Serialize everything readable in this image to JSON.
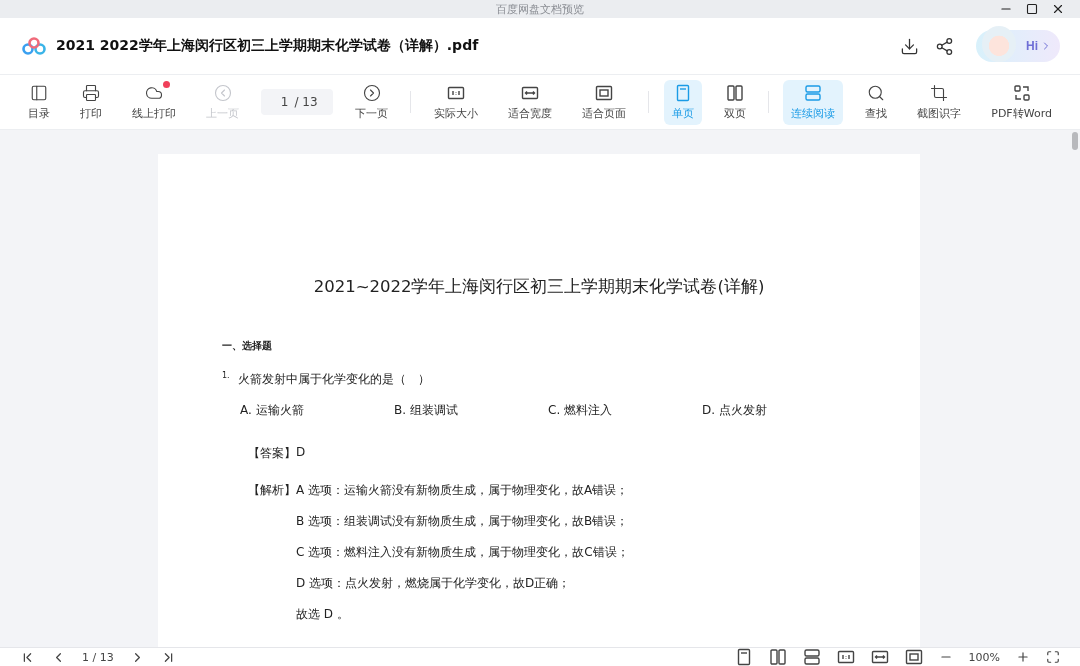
{
  "window": {
    "title": "百度网盘文档预览"
  },
  "header": {
    "file_name": "2021 2022学年上海闵行区初三上学期期末化学试卷（详解）.pdf",
    "assistant_label": "Hi"
  },
  "toolbar": [
    [
      {
        "kind": "button",
        "label": "目录",
        "disabled": false,
        "selected": false,
        "badge": false
      },
      {
        "kind": "button",
        "label": "打印",
        "disabled": false,
        "selected": false,
        "badge": false
      },
      {
        "kind": "button",
        "label": "线上打印",
        "disabled": false,
        "selected": false,
        "badge": true
      },
      {
        "kind": "button",
        "label": "上一页",
        "disabled": true,
        "selected": false,
        "badge": false
      },
      {
        "kind": "page",
        "value": "1",
        "total": "/ 13"
      },
      {
        "kind": "button",
        "label": "下一页",
        "disabled": false,
        "selected": false,
        "badge": false
      }
    ],
    [
      {
        "kind": "button",
        "label": "实际大小",
        "disabled": false,
        "selected": false,
        "badge": false
      },
      {
        "kind": "button",
        "label": "适合宽度",
        "disabled": false,
        "selected": false,
        "badge": false
      },
      {
        "kind": "button",
        "label": "适合页面",
        "disabled": false,
        "selected": false,
        "badge": false
      }
    ],
    [
      {
        "kind": "button",
        "label": "单页",
        "disabled": false,
        "selected": true,
        "badge": false
      },
      {
        "kind": "button",
        "label": "双页",
        "disabled": false,
        "selected": false,
        "badge": false
      }
    ],
    [
      {
        "kind": "button",
        "label": "连续阅读",
        "disabled": false,
        "selected": true,
        "badge": false
      },
      {
        "kind": "button",
        "label": "查找",
        "disabled": false,
        "selected": false,
        "badge": false
      },
      {
        "kind": "button",
        "label": "截图识字",
        "disabled": false,
        "selected": false,
        "badge": false
      },
      {
        "kind": "button",
        "label": "PDF转Word",
        "disabled": false,
        "selected": false,
        "badge": false
      }
    ]
  ],
  "document": {
    "title": "2021~2022学年上海闵行区初三上学期期末化学试卷(详解)",
    "section": "一、选择题",
    "questions": [
      {
        "number": "1.",
        "text": "火箭发射中属于化学变化的是（　）",
        "options": [
          "A. 运输火箭",
          "B. 组装调试",
          "C. 燃料注入",
          "D. 点火发射"
        ],
        "answer_label": "【答案】",
        "answer": "D",
        "analysis_label": "【解析】",
        "analysis": [
          "A 选项：运输火箭没有新物质生成，属于物理变化，故A错误；",
          "B 选项：组装调试没有新物质生成，属于物理变化，故B错误；",
          "C 选项：燃料注入没有新物质生成，属于物理变化，故C错误；",
          "D 选项：点火发射，燃烧属于化学变化，故D正确；",
          "故选 D 。"
        ]
      }
    ]
  },
  "status_bar": {
    "page_indicator": "1 / 13",
    "zoom": "100%"
  }
}
